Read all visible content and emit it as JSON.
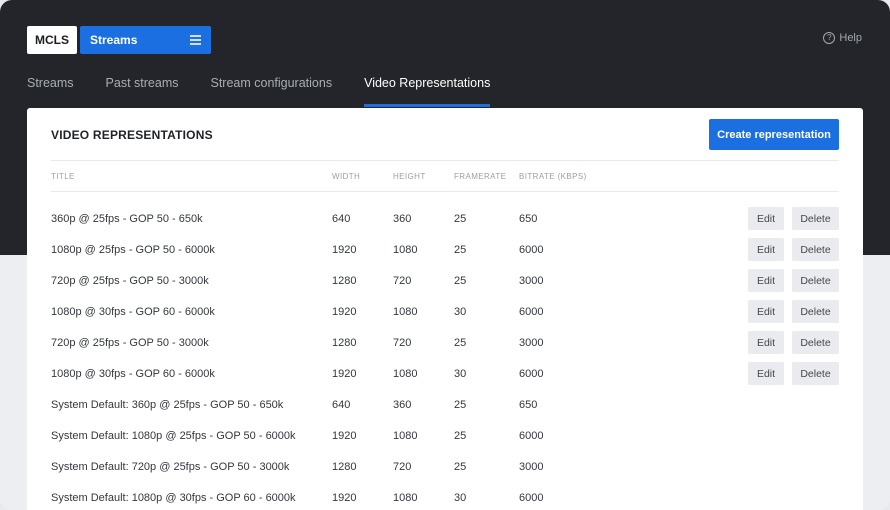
{
  "header": {
    "logo": "MCLS",
    "streams_select": "Streams",
    "help": "Help"
  },
  "nav": {
    "tabs": [
      {
        "label": "Streams",
        "active": false
      },
      {
        "label": "Past streams",
        "active": false
      },
      {
        "label": "Stream configurations",
        "active": false
      },
      {
        "label": "Video Representations",
        "active": true
      }
    ]
  },
  "card": {
    "title": "VIDEO REPRESENTATIONS",
    "create_button": "Create representation",
    "columns": [
      "TITLE",
      "WIDTH",
      "HEIGHT",
      "FRAMERATE",
      "BITRATE (KBPS)"
    ],
    "edit_label": "Edit",
    "delete_label": "Delete",
    "rows": [
      {
        "title": "360p @ 25fps - GOP 50 - 650k",
        "width": "640",
        "height": "360",
        "framerate": "25",
        "bitrate": "650",
        "editable": true
      },
      {
        "title": "1080p @ 25fps - GOP 50 - 6000k",
        "width": "1920",
        "height": "1080",
        "framerate": "25",
        "bitrate": "6000",
        "editable": true
      },
      {
        "title": "720p @ 25fps - GOP 50 - 3000k",
        "width": "1280",
        "height": "720",
        "framerate": "25",
        "bitrate": "3000",
        "editable": true
      },
      {
        "title": "1080p @ 30fps - GOP 60 - 6000k",
        "width": "1920",
        "height": "1080",
        "framerate": "30",
        "bitrate": "6000",
        "editable": true
      },
      {
        "title": "720p @ 25fps - GOP 50 - 3000k",
        "width": "1280",
        "height": "720",
        "framerate": "25",
        "bitrate": "3000",
        "editable": true
      },
      {
        "title": "1080p @ 30fps - GOP 60 - 6000k",
        "width": "1920",
        "height": "1080",
        "framerate": "30",
        "bitrate": "6000",
        "editable": true
      },
      {
        "title": "System Default: 360p @ 25fps - GOP 50 - 650k",
        "width": "640",
        "height": "360",
        "framerate": "25",
        "bitrate": "650",
        "editable": false
      },
      {
        "title": "System Default: 1080p @ 25fps - GOP 50 - 6000k",
        "width": "1920",
        "height": "1080",
        "framerate": "25",
        "bitrate": "6000",
        "editable": false
      },
      {
        "title": "System Default: 720p @ 25fps - GOP 50 - 3000k",
        "width": "1280",
        "height": "720",
        "framerate": "25",
        "bitrate": "3000",
        "editable": false
      },
      {
        "title": "System Default: 1080p @ 30fps - GOP 60 - 6000k",
        "width": "1920",
        "height": "1080",
        "framerate": "30",
        "bitrate": "6000",
        "editable": false
      }
    ]
  },
  "colors": {
    "accent": "#1c6fe0",
    "topbar": "#23252a"
  },
  "icons": {
    "menu": "hamburger-icon",
    "help": "question-circle-icon"
  }
}
